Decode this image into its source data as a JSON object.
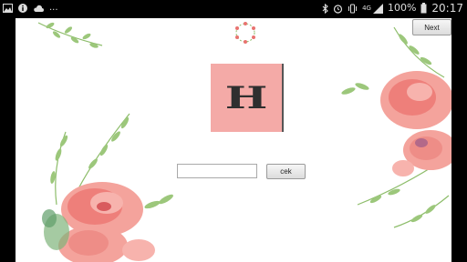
{
  "status_bar": {
    "left_icons": [
      "picture-icon",
      "info-icon",
      "cloud-icon"
    ],
    "more": "...",
    "right_icons": [
      "bluetooth-icon",
      "alarm-icon",
      "vibrate-icon",
      "signal-icon"
    ],
    "network": "4G",
    "battery": "100%",
    "time": "20:17"
  },
  "toolbar": {
    "next_label": "Next"
  },
  "quiz": {
    "logo_letter": "H",
    "answer_value": "",
    "check_label": "cek"
  },
  "colors": {
    "tile": "#f4aaa7",
    "petal": "#f08c88",
    "petal_light": "#f7b3ad",
    "leaf": "#8dbd6a"
  }
}
